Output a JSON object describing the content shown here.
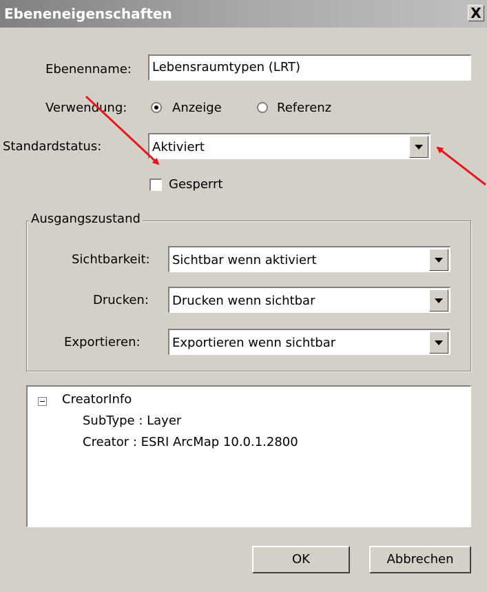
{
  "window": {
    "title": "Ebeneneigenschaften",
    "close_label": "X"
  },
  "layer_name": {
    "label": "Ebenenname:",
    "value": "Lebensraumtypen (LRT)"
  },
  "usage": {
    "label": "Verwendung:",
    "options": [
      {
        "label": "Anzeige",
        "checked": true
      },
      {
        "label": "Referenz",
        "checked": false
      }
    ]
  },
  "default_status": {
    "label": "Standardstatus:",
    "value": "Aktiviert"
  },
  "locked": {
    "label": "Gesperrt",
    "checked": false
  },
  "initial_state": {
    "legend": "Ausgangszustand",
    "visibility": {
      "label": "Sichtbarkeit:",
      "value": "Sichtbar wenn aktiviert"
    },
    "print": {
      "label": "Drucken:",
      "value": "Drucken wenn sichtbar"
    },
    "export": {
      "label": "Exportieren:",
      "value": "Exportieren wenn sichtbar"
    }
  },
  "creator_info": {
    "root": "CreatorInfo",
    "items": [
      "SubType : Layer",
      "Creator : ESRI ArcMap 10.0.1.2800"
    ]
  },
  "buttons": {
    "ok": "OK",
    "cancel": "Abbrechen"
  },
  "colors": {
    "annotation_arrow": "#e8141c"
  }
}
